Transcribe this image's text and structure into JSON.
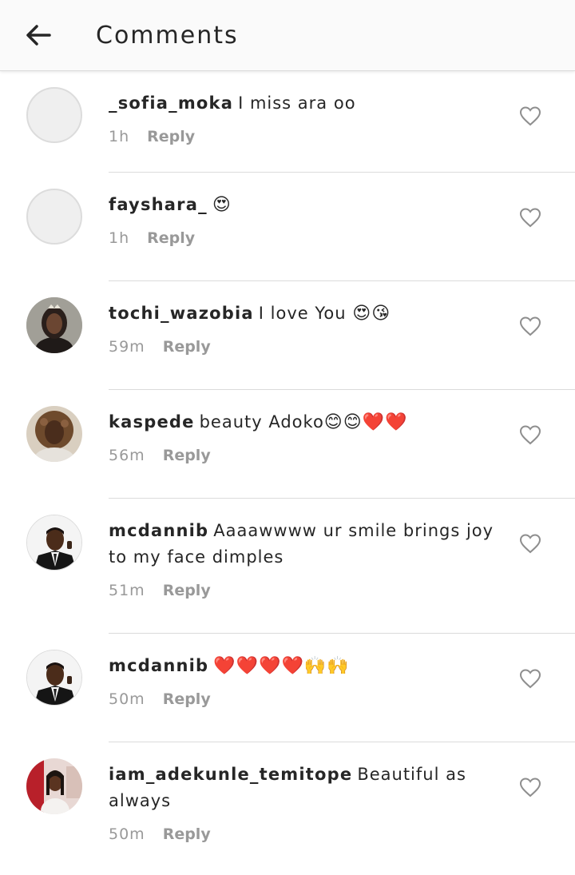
{
  "header": {
    "title": "Comments",
    "back_icon": "arrow-left-icon"
  },
  "comments": [
    {
      "username": "_sofia_moka",
      "text": "I miss ara oo",
      "emoji": "",
      "time": "1h",
      "reply": "Reply",
      "avatar": "empty"
    },
    {
      "username": "fayshara_",
      "text": "",
      "emoji": "😍",
      "time": "1h",
      "reply": "Reply",
      "avatar": "empty"
    },
    {
      "username": "tochi_wazobia",
      "text": "I love You",
      "emoji": "😍😘",
      "time": "59m",
      "reply": "Reply",
      "avatar": "photo"
    },
    {
      "username": "kaspede",
      "text": "beauty Adoko",
      "emoji": "😊😊",
      "hearts": "❤️❤️",
      "time": "56m",
      "reply": "Reply",
      "avatar": "photo"
    },
    {
      "username": "mcdannib",
      "text": "Aaaawwww ur smile brings joy to my face dimples",
      "emoji": "",
      "time": "51m",
      "reply": "Reply",
      "avatar": "photo"
    },
    {
      "username": "mcdannib",
      "text": "",
      "emoji": "🙌🙌",
      "hearts": "❤️❤️❤️❤️",
      "time": "50m",
      "reply": "Reply",
      "avatar": "photo"
    },
    {
      "username": "iam_adekunle_temitope",
      "text": "Beautiful  as always",
      "emoji": "",
      "time": "50m",
      "reply": "Reply",
      "avatar": "photo"
    }
  ],
  "colors": {
    "heart": "#e9468a",
    "muted": "#999999",
    "divider": "#dbdbdb"
  }
}
